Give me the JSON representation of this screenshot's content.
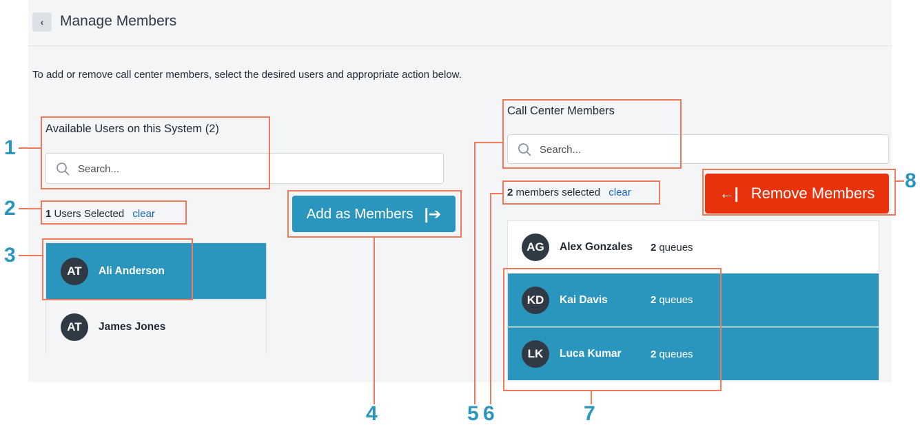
{
  "header": {
    "back_icon": "chevron-left-icon",
    "title": "Manage Members"
  },
  "instructions": "To add or remove call center members, select the desired users and appropriate action below.",
  "available": {
    "label": "Available Users on this System (2)",
    "search_placeholder": "Search...",
    "selected_count": "1",
    "selected_text": "Users Selected",
    "clear_label": "clear",
    "users": [
      {
        "initials": "AT",
        "name": "Ali Anderson",
        "selected": true
      },
      {
        "initials": "AT",
        "name": "James Jones",
        "selected": false
      }
    ]
  },
  "add_button": {
    "label": "Add as Members",
    "icon": "arrow-right-to-bar-icon",
    "glyph": "|➔"
  },
  "members": {
    "label": "Call Center Members",
    "search_placeholder": "Search...",
    "selected_count": "2",
    "selected_text": "members selected",
    "clear_label": "clear",
    "users": [
      {
        "initials": "AG",
        "name": "Alex Gonzales",
        "queue_count": "2",
        "queue_text": "queues",
        "selected": false
      },
      {
        "initials": "KD",
        "name": "Kai Davis",
        "queue_count": "2",
        "queue_text": "queues",
        "selected": true
      },
      {
        "initials": "LK",
        "name": "Luca Kumar",
        "queue_count": "2",
        "queue_text": "queues",
        "selected": true
      }
    ]
  },
  "remove_button": {
    "label": "Remove Members",
    "icon": "arrow-left-to-bar-icon",
    "glyph": "←|"
  },
  "annotations": [
    "1",
    "2",
    "3",
    "4",
    "5",
    "6",
    "7",
    "8"
  ],
  "colors": {
    "accent": "#2b96bd",
    "danger": "#e8320b",
    "annotation": "#f2785a",
    "link": "#1565c0"
  }
}
